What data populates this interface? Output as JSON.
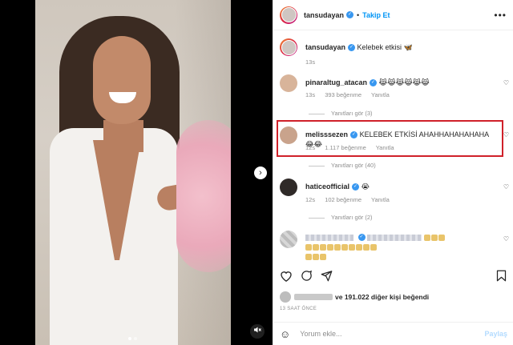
{
  "post": {
    "author": "tansudayan",
    "follow_label": "Takip Et",
    "more_label": "•••"
  },
  "caption": {
    "username": "tansudayan",
    "text": "Kelebek etkisi 🦋",
    "time": "13s"
  },
  "comments": [
    {
      "username": "pinaraltug_atacan",
      "text": "😹😹😹😹😹😹",
      "time": "13s",
      "likes": "393 beğenme",
      "reply_label": "Yanıtla",
      "replies": "Yanıtları gör (3)"
    },
    {
      "username": "melisssezen",
      "text": "KELEBEK ETKİSİ AHAHHAHAHAHAHA😂😂",
      "time": "12s",
      "likes": "1.117 beğenme",
      "reply_label": "Yanıtla",
      "replies": "Yanıtları gör (40)"
    },
    {
      "username": "haticeofficial",
      "text": "😭",
      "time": "12s",
      "likes": "102 beğenme",
      "reply_label": "Yanıtla",
      "replies": "Yanıtları gör (2)"
    }
  ],
  "likes_line": {
    "text": "ve 191.022 diğer kişi beğendi"
  },
  "timestamp": "13 SAAT ÖNCE",
  "add_comment": {
    "placeholder": "Yorum ekle...",
    "post_label": "Paylaş"
  },
  "icons": {
    "heart": "heart-icon",
    "comment": "comment-icon",
    "share": "share-icon",
    "save": "bookmark-icon",
    "emoji": "emoji-icon",
    "next": "chevron-right-icon",
    "mute": "speaker-muted-icon"
  },
  "colors": {
    "accent": "#0095f6",
    "highlight": "#d0212a",
    "verified": "#3897f0"
  }
}
